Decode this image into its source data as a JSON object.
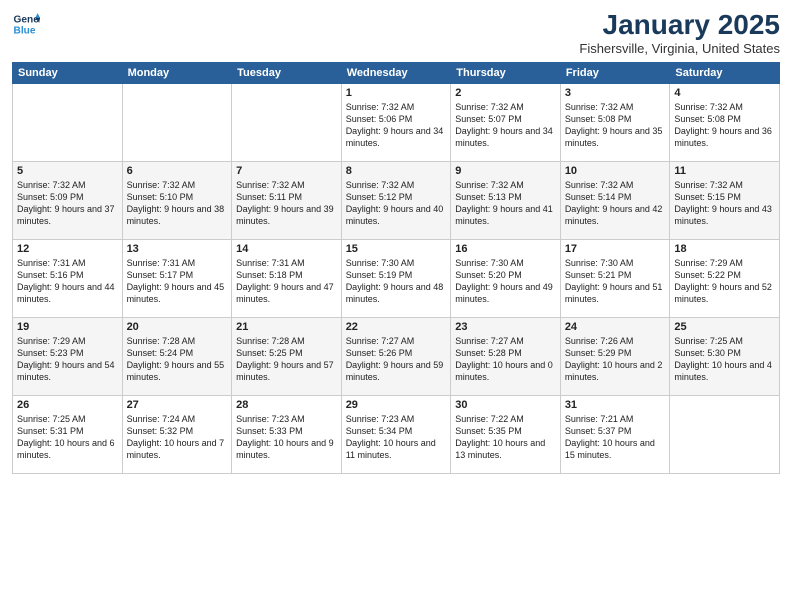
{
  "header": {
    "logo_line1": "General",
    "logo_line2": "Blue",
    "month": "January 2025",
    "location": "Fishersville, Virginia, United States"
  },
  "weekdays": [
    "Sunday",
    "Monday",
    "Tuesday",
    "Wednesday",
    "Thursday",
    "Friday",
    "Saturday"
  ],
  "weeks": [
    [
      {
        "day": "",
        "sunrise": "",
        "sunset": "",
        "daylight": ""
      },
      {
        "day": "",
        "sunrise": "",
        "sunset": "",
        "daylight": ""
      },
      {
        "day": "",
        "sunrise": "",
        "sunset": "",
        "daylight": ""
      },
      {
        "day": "1",
        "sunrise": "Sunrise: 7:32 AM",
        "sunset": "Sunset: 5:06 PM",
        "daylight": "Daylight: 9 hours and 34 minutes."
      },
      {
        "day": "2",
        "sunrise": "Sunrise: 7:32 AM",
        "sunset": "Sunset: 5:07 PM",
        "daylight": "Daylight: 9 hours and 34 minutes."
      },
      {
        "day": "3",
        "sunrise": "Sunrise: 7:32 AM",
        "sunset": "Sunset: 5:08 PM",
        "daylight": "Daylight: 9 hours and 35 minutes."
      },
      {
        "day": "4",
        "sunrise": "Sunrise: 7:32 AM",
        "sunset": "Sunset: 5:08 PM",
        "daylight": "Daylight: 9 hours and 36 minutes."
      }
    ],
    [
      {
        "day": "5",
        "sunrise": "Sunrise: 7:32 AM",
        "sunset": "Sunset: 5:09 PM",
        "daylight": "Daylight: 9 hours and 37 minutes."
      },
      {
        "day": "6",
        "sunrise": "Sunrise: 7:32 AM",
        "sunset": "Sunset: 5:10 PM",
        "daylight": "Daylight: 9 hours and 38 minutes."
      },
      {
        "day": "7",
        "sunrise": "Sunrise: 7:32 AM",
        "sunset": "Sunset: 5:11 PM",
        "daylight": "Daylight: 9 hours and 39 minutes."
      },
      {
        "day": "8",
        "sunrise": "Sunrise: 7:32 AM",
        "sunset": "Sunset: 5:12 PM",
        "daylight": "Daylight: 9 hours and 40 minutes."
      },
      {
        "day": "9",
        "sunrise": "Sunrise: 7:32 AM",
        "sunset": "Sunset: 5:13 PM",
        "daylight": "Daylight: 9 hours and 41 minutes."
      },
      {
        "day": "10",
        "sunrise": "Sunrise: 7:32 AM",
        "sunset": "Sunset: 5:14 PM",
        "daylight": "Daylight: 9 hours and 42 minutes."
      },
      {
        "day": "11",
        "sunrise": "Sunrise: 7:32 AM",
        "sunset": "Sunset: 5:15 PM",
        "daylight": "Daylight: 9 hours and 43 minutes."
      }
    ],
    [
      {
        "day": "12",
        "sunrise": "Sunrise: 7:31 AM",
        "sunset": "Sunset: 5:16 PM",
        "daylight": "Daylight: 9 hours and 44 minutes."
      },
      {
        "day": "13",
        "sunrise": "Sunrise: 7:31 AM",
        "sunset": "Sunset: 5:17 PM",
        "daylight": "Daylight: 9 hours and 45 minutes."
      },
      {
        "day": "14",
        "sunrise": "Sunrise: 7:31 AM",
        "sunset": "Sunset: 5:18 PM",
        "daylight": "Daylight: 9 hours and 47 minutes."
      },
      {
        "day": "15",
        "sunrise": "Sunrise: 7:30 AM",
        "sunset": "Sunset: 5:19 PM",
        "daylight": "Daylight: 9 hours and 48 minutes."
      },
      {
        "day": "16",
        "sunrise": "Sunrise: 7:30 AM",
        "sunset": "Sunset: 5:20 PM",
        "daylight": "Daylight: 9 hours and 49 minutes."
      },
      {
        "day": "17",
        "sunrise": "Sunrise: 7:30 AM",
        "sunset": "Sunset: 5:21 PM",
        "daylight": "Daylight: 9 hours and 51 minutes."
      },
      {
        "day": "18",
        "sunrise": "Sunrise: 7:29 AM",
        "sunset": "Sunset: 5:22 PM",
        "daylight": "Daylight: 9 hours and 52 minutes."
      }
    ],
    [
      {
        "day": "19",
        "sunrise": "Sunrise: 7:29 AM",
        "sunset": "Sunset: 5:23 PM",
        "daylight": "Daylight: 9 hours and 54 minutes."
      },
      {
        "day": "20",
        "sunrise": "Sunrise: 7:28 AM",
        "sunset": "Sunset: 5:24 PM",
        "daylight": "Daylight: 9 hours and 55 minutes."
      },
      {
        "day": "21",
        "sunrise": "Sunrise: 7:28 AM",
        "sunset": "Sunset: 5:25 PM",
        "daylight": "Daylight: 9 hours and 57 minutes."
      },
      {
        "day": "22",
        "sunrise": "Sunrise: 7:27 AM",
        "sunset": "Sunset: 5:26 PM",
        "daylight": "Daylight: 9 hours and 59 minutes."
      },
      {
        "day": "23",
        "sunrise": "Sunrise: 7:27 AM",
        "sunset": "Sunset: 5:28 PM",
        "daylight": "Daylight: 10 hours and 0 minutes."
      },
      {
        "day": "24",
        "sunrise": "Sunrise: 7:26 AM",
        "sunset": "Sunset: 5:29 PM",
        "daylight": "Daylight: 10 hours and 2 minutes."
      },
      {
        "day": "25",
        "sunrise": "Sunrise: 7:25 AM",
        "sunset": "Sunset: 5:30 PM",
        "daylight": "Daylight: 10 hours and 4 minutes."
      }
    ],
    [
      {
        "day": "26",
        "sunrise": "Sunrise: 7:25 AM",
        "sunset": "Sunset: 5:31 PM",
        "daylight": "Daylight: 10 hours and 6 minutes."
      },
      {
        "day": "27",
        "sunrise": "Sunrise: 7:24 AM",
        "sunset": "Sunset: 5:32 PM",
        "daylight": "Daylight: 10 hours and 7 minutes."
      },
      {
        "day": "28",
        "sunrise": "Sunrise: 7:23 AM",
        "sunset": "Sunset: 5:33 PM",
        "daylight": "Daylight: 10 hours and 9 minutes."
      },
      {
        "day": "29",
        "sunrise": "Sunrise: 7:23 AM",
        "sunset": "Sunset: 5:34 PM",
        "daylight": "Daylight: 10 hours and 11 minutes."
      },
      {
        "day": "30",
        "sunrise": "Sunrise: 7:22 AM",
        "sunset": "Sunset: 5:35 PM",
        "daylight": "Daylight: 10 hours and 13 minutes."
      },
      {
        "day": "31",
        "sunrise": "Sunrise: 7:21 AM",
        "sunset": "Sunset: 5:37 PM",
        "daylight": "Daylight: 10 hours and 15 minutes."
      },
      {
        "day": "",
        "sunrise": "",
        "sunset": "",
        "daylight": ""
      }
    ]
  ]
}
